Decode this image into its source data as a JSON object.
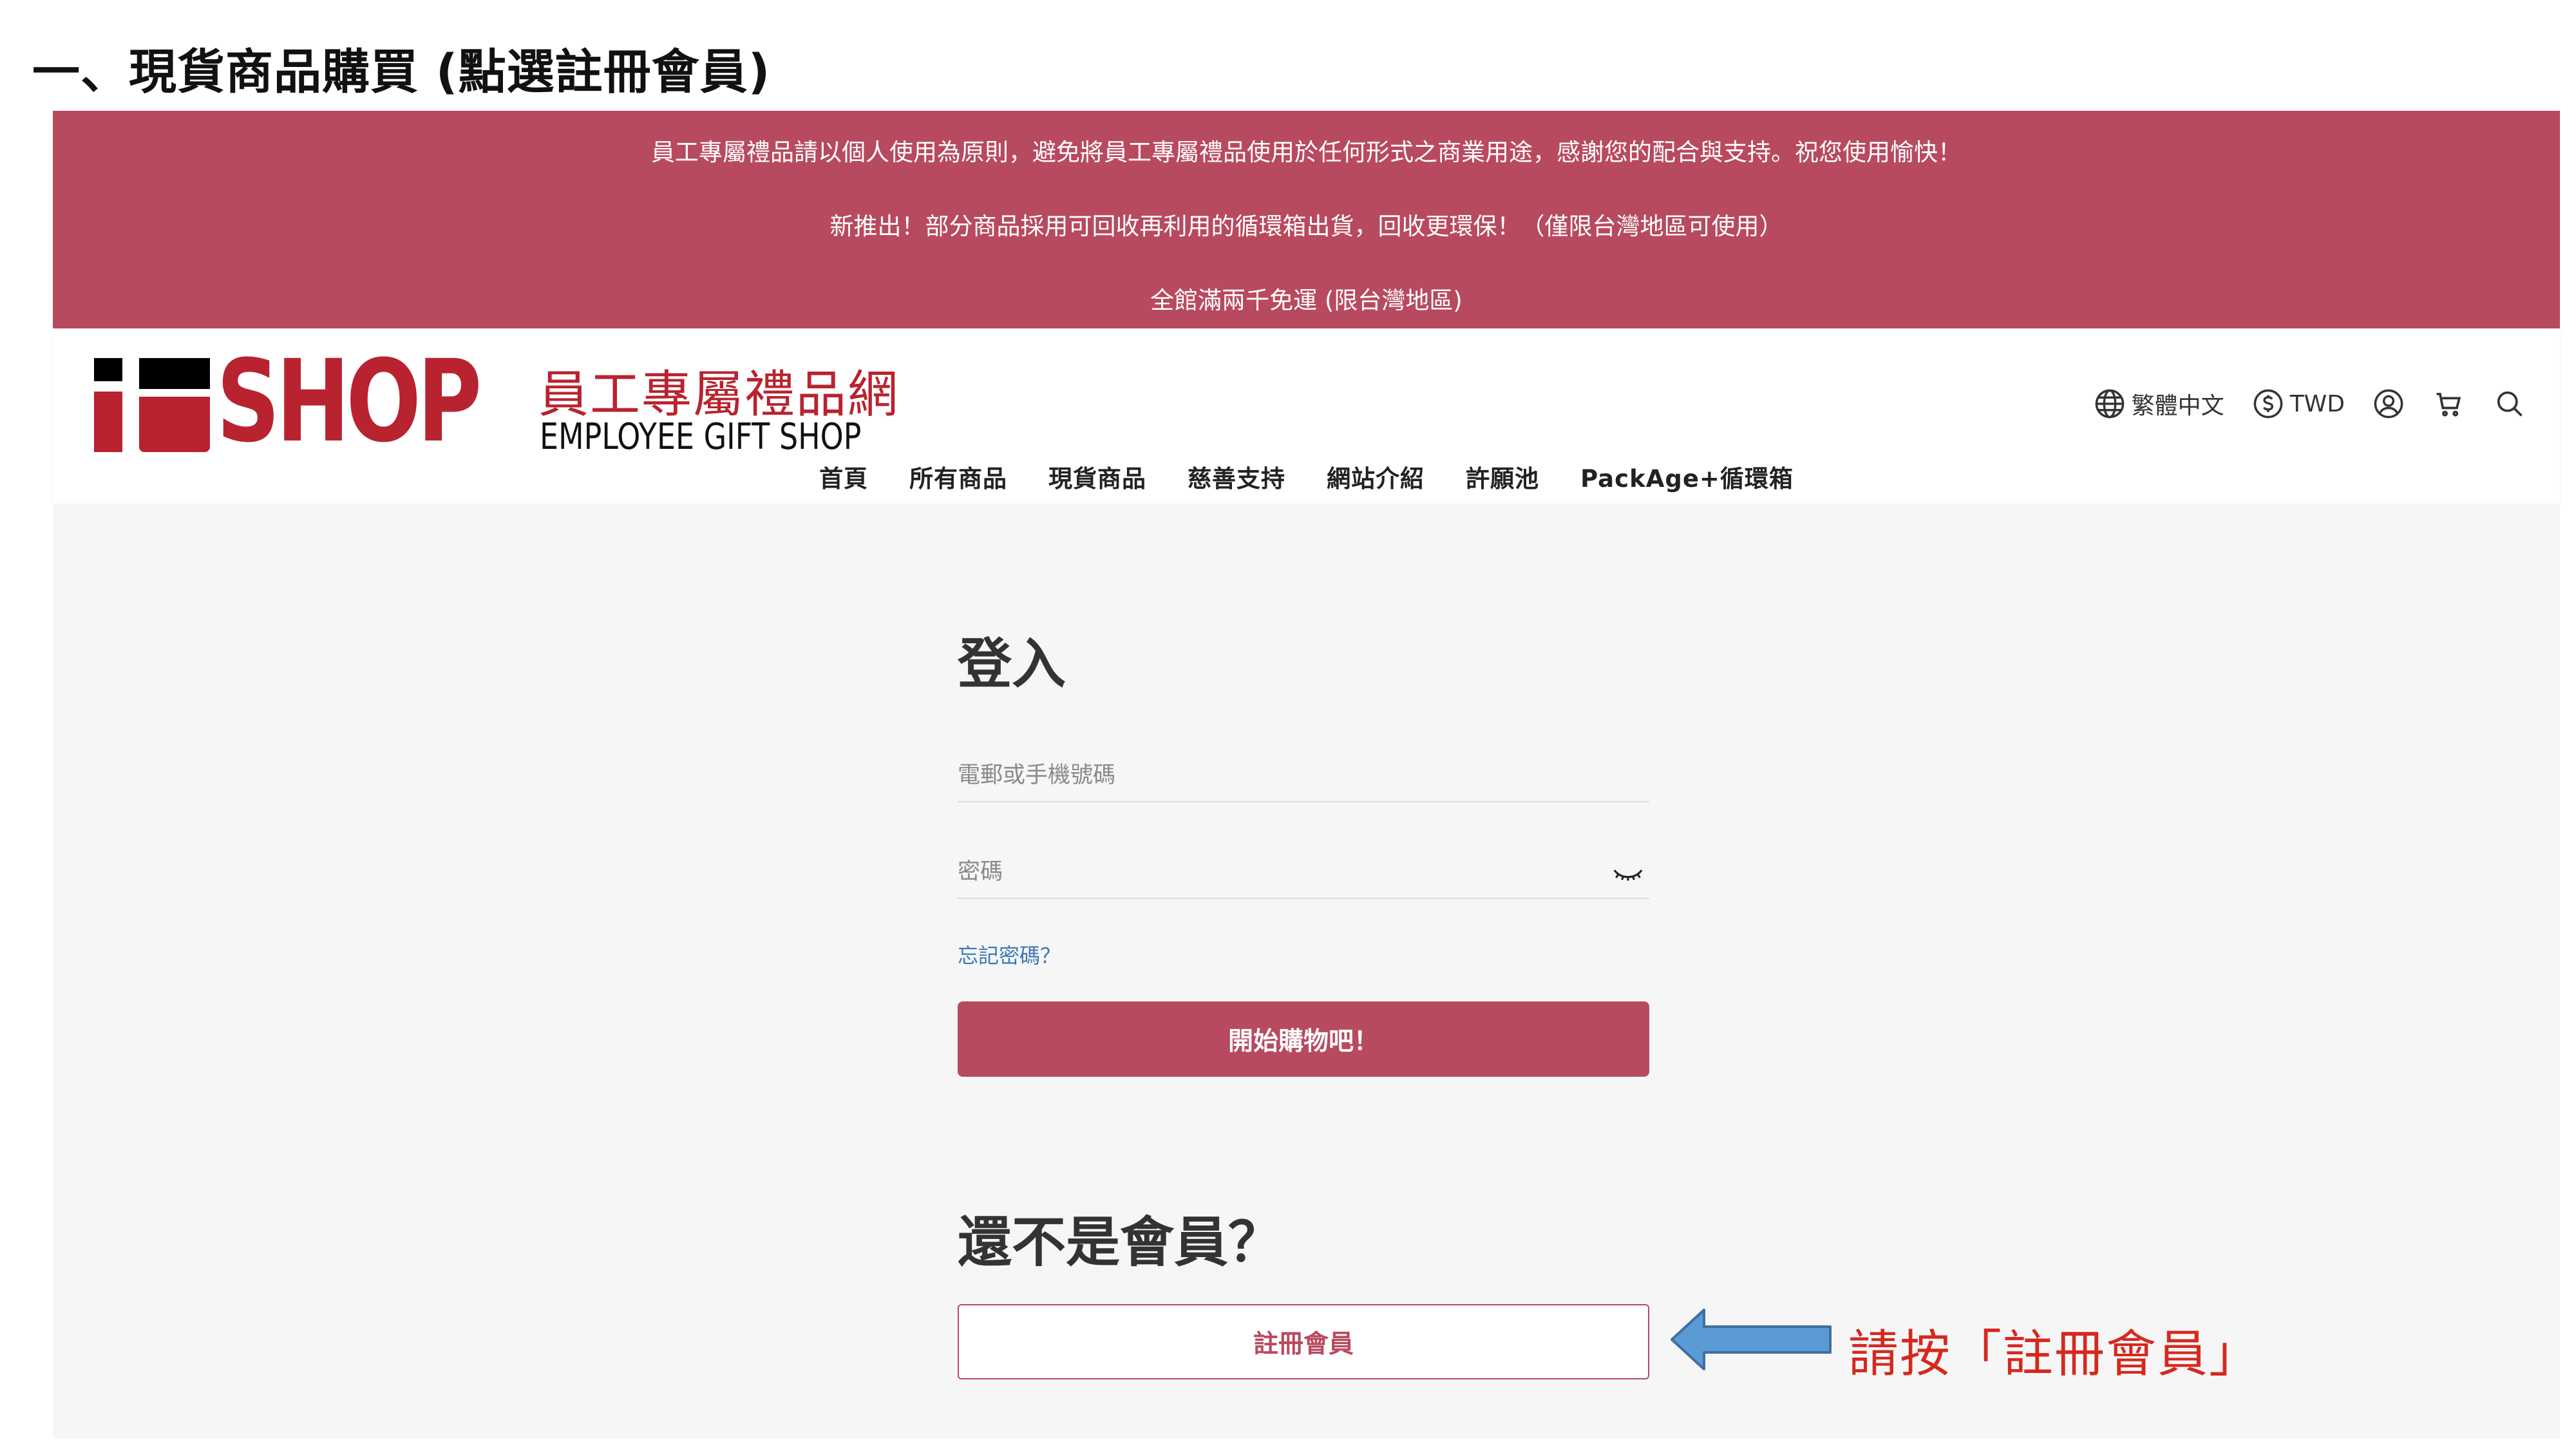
{
  "slide": {
    "title": "一、現貨商品購買 (點選註冊會員)"
  },
  "announcement": {
    "lines": [
      "員工專屬禮品請以個人使用為原則，避免將員工專屬禮品使用於任何形式之商業用途，感謝您的配合與支持。祝您使用愉快！",
      "新推出！部分商品採用可回收再利用的循環箱出貨，回收更環保！（僅限台灣地區可使用）",
      "全館滿兩千免運 (限台灣地區)"
    ]
  },
  "logo": {
    "wordmark": "SHOP",
    "cn": "員工專屬禮品網",
    "en": "EMPLOYEE GIFT SHOP"
  },
  "utility": {
    "language": "繁體中文",
    "currency": "TWD",
    "icons": [
      "globe-icon",
      "dollar-icon",
      "user-icon",
      "cart-icon",
      "search-icon"
    ]
  },
  "nav": {
    "items": [
      "首頁",
      "所有商品",
      "現貨商品",
      "慈善支持",
      "網站介紹",
      "許願池",
      "PackAge+循環箱"
    ]
  },
  "login": {
    "title": "登入",
    "email_placeholder": "電郵或手機號碼",
    "password_placeholder": "密碼",
    "forgot": "忘記密碼？",
    "submit": "開始購物吧！"
  },
  "register": {
    "title": "還不是會員？",
    "button": "註冊會員"
  },
  "annotation": {
    "hint": "請按「註冊會員」"
  },
  "colors": {
    "brand": "#b84a5f",
    "logo_red": "#b8232f",
    "link": "#3a78b8",
    "hint": "#d6281f",
    "arrow": "#5b9bd5"
  }
}
